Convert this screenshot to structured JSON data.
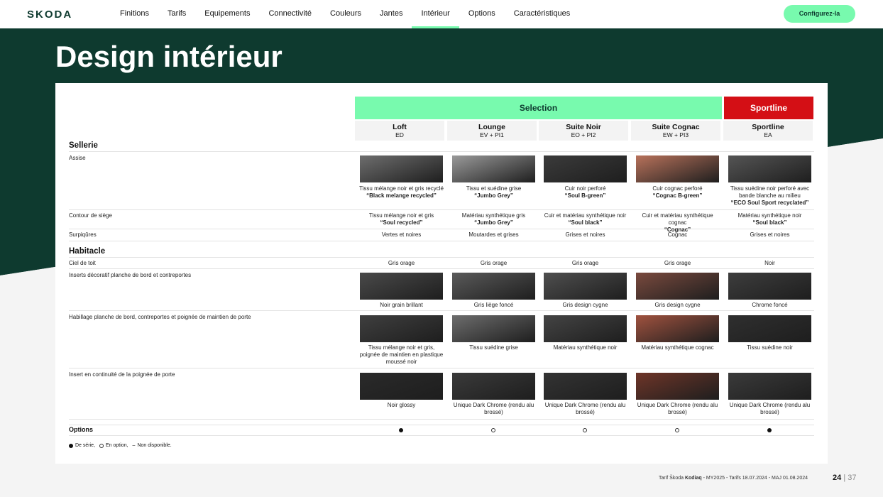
{
  "brand": "SKODA",
  "nav": [
    "Finitions",
    "Tarifs",
    "Equipements",
    "Connectivité",
    "Couleurs",
    "Jantes",
    "Intérieur",
    "Options",
    "Caractéristiques"
  ],
  "nav_active": 6,
  "cta": "Configurez-la",
  "title": "Design intérieur",
  "band": {
    "selection": "Selection",
    "sportline": "Sportline"
  },
  "columns": [
    {
      "name": "Loft",
      "code": "ED"
    },
    {
      "name": "Lounge",
      "code": "EV + PI1"
    },
    {
      "name": "Suite Noir",
      "code": "EO + PI2"
    },
    {
      "name": "Suite Cognac",
      "code": "EW + PI3"
    },
    {
      "name": "Sportline",
      "code": "EA"
    }
  ],
  "sections": {
    "sellerie": "Sellerie",
    "habitacle": "Habitacle",
    "options": "Options"
  },
  "rows": {
    "assise": {
      "label": "Assise",
      "cells": [
        {
          "t": "Tissu mélange noir et gris recyclé",
          "b": "“Black melange recycled”"
        },
        {
          "t": "Tissu et suédine grise",
          "b": "“Jumbo Grey”"
        },
        {
          "t": "Cuir noir perforé",
          "b": "“Soul B-green”"
        },
        {
          "t": "Cuir cognac perforé",
          "b": "“Cognac B-green”"
        },
        {
          "t": "Tissu suédine noir perforé avec bande blanche au milieu",
          "b": "“ECO Soul Sport recyclated”"
        }
      ],
      "colors": [
        "#6e6e6e",
        "#9a9a9a",
        "#3b3b3b",
        "#b8725b",
        "#555555"
      ]
    },
    "contour": {
      "label": "Contour de siège",
      "cells": [
        {
          "t": "Tissu mélange noir et gris",
          "b": "“Soul recycled”"
        },
        {
          "t": "Matériau synthétique gris",
          "b": "“Jumbo Grey”"
        },
        {
          "t": "Cuir et matériau synthétique noir",
          "b": "“Soul black”"
        },
        {
          "t": "Cuir et matériau synthétique cognac",
          "b": "“Cognac”"
        },
        {
          "t": "Matériau synthétique noir",
          "b": "“Soul black”"
        }
      ]
    },
    "surpiqures": {
      "label": "Surpiqûres",
      "cells": [
        "Vertes et noires",
        "Moutardes et grises",
        "Grises et noires",
        "Cognac",
        "Grises et noires"
      ]
    },
    "ciel": {
      "label": "Ciel de toit",
      "cells": [
        "Gris orage",
        "Gris orage",
        "Gris orage",
        "Gris orage",
        "Noir"
      ]
    },
    "inserts": {
      "label": "Inserts décoratif planche de bord et contreportes",
      "cells": [
        "Noir grain brillant",
        "Gris liège foncé",
        "Gris design cygne",
        "Gris design cygne",
        "Chrome foncé"
      ],
      "colors": [
        "#4a4a4a",
        "#5a5a5a",
        "#4f4f4f",
        "#7a4a3e",
        "#3d3d3d"
      ]
    },
    "habillage": {
      "label": "Habillage planche de bord, contreportes et poignée de maintien de porte",
      "cells": [
        "Tissu mélange noir et gris, poignée de maintien en plastique moussé noir",
        "Tissu suédine grise",
        "Matériau synthétique noir",
        "Matériau synthétique cognac",
        "Tissu suédine noir"
      ],
      "colors": [
        "#3f3f3f",
        "#6d6d6d",
        "#444444",
        "#a0523f",
        "#2f2f2f"
      ]
    },
    "insert_poignee": {
      "label": "Insert en continuité de la poignée de porte",
      "cells": [
        "Noir glossy",
        "Unique Dark Chrome (rendu alu brossé)",
        "Unique Dark Chrome (rendu alu brossé)",
        "Unique Dark Chrome (rendu alu brossé)",
        "Unique Dark Chrome (rendu alu brossé)"
      ],
      "colors": [
        "#2a2a2a",
        "#3a3a3a",
        "#333333",
        "#6e3528",
        "#3a3a3a"
      ]
    },
    "options": {
      "marks": [
        "full",
        "open",
        "open",
        "open",
        "full"
      ]
    }
  },
  "legend": {
    "serie": "De série,",
    "option": "En option,",
    "na": "Non disponible."
  },
  "footer": {
    "pre": "Tarif Škoda ",
    "model": "Kodiaq",
    "post": " - MY2025 - Tarifs 18.07.2024 - MAJ 01.08.2024"
  },
  "page": {
    "current": "24",
    "total": "37"
  }
}
